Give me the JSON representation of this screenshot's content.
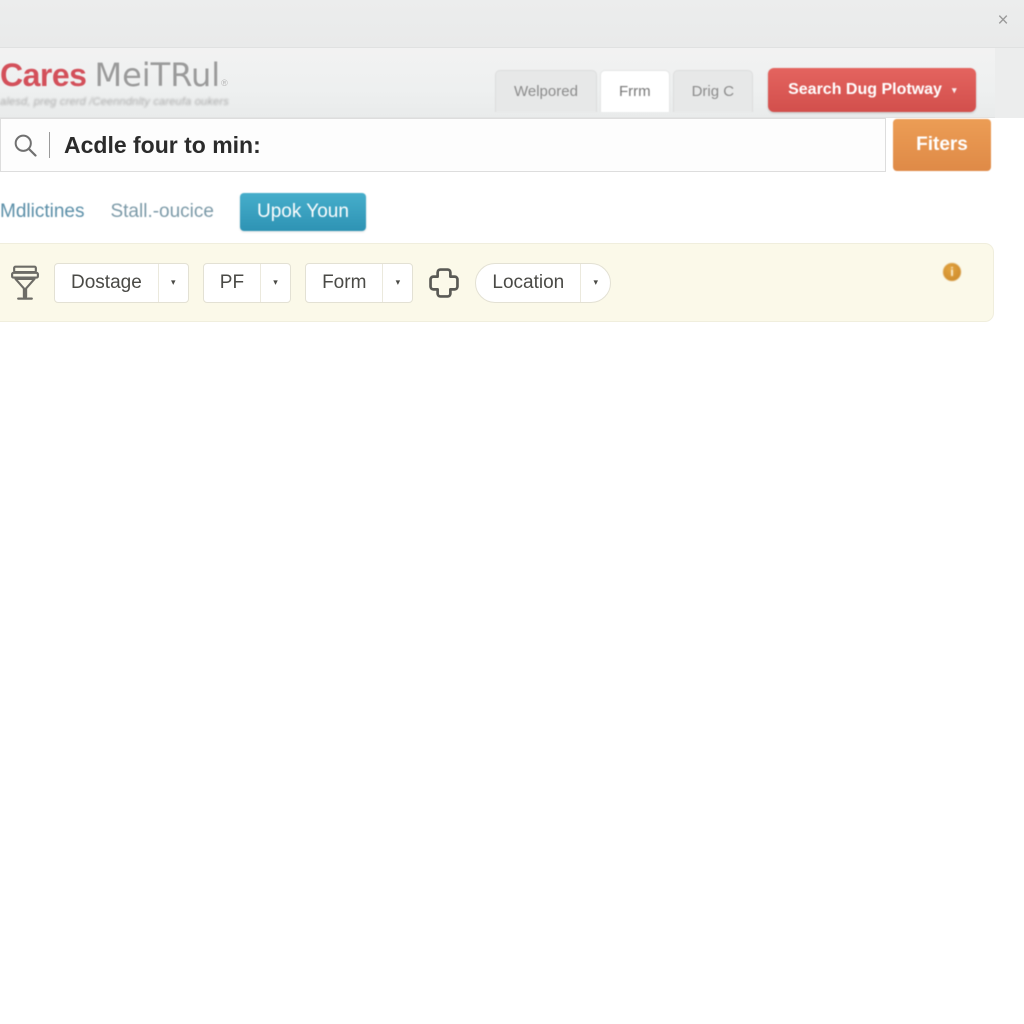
{
  "window": {
    "close_label": "×"
  },
  "header": {
    "logo": {
      "primary": "Cares",
      "secondary": "MeiTRul",
      "trademark": "®",
      "tagline": "alesd, preg crerd /Ceenndnlty careufa oukers"
    },
    "tabs": [
      {
        "label": "Welpored",
        "active": false
      },
      {
        "label": "Frrm",
        "active": true
      },
      {
        "label": "Drig C",
        "active": false
      }
    ],
    "action_button": {
      "label": "Search Dug Plotway",
      "caret": "▾",
      "color": "#d7554f"
    }
  },
  "search": {
    "icon": "search-icon",
    "value": "Acdle four to min:",
    "placeholder": "Acdle four to min:",
    "filters_label": "Fiters",
    "filters_color": "#e4924e"
  },
  "subnav": {
    "links": [
      {
        "label": "Mdlictines",
        "active": false
      },
      {
        "label": "Stall.-oucice",
        "active": false
      }
    ],
    "active_pill": {
      "label": "Upok Youn",
      "color": "#2e93b4"
    }
  },
  "filterbar": {
    "background": "#fbf9e9",
    "icon": "funnel-icon",
    "dropdowns": [
      {
        "label": "Dostage",
        "caret": "▾",
        "shape": "rect"
      },
      {
        "label": "PF",
        "caret": "▾",
        "shape": "rect"
      },
      {
        "label": "Form",
        "caret": "▾",
        "shape": "rect"
      }
    ],
    "add_icon": "plus-icon",
    "location_dropdown": {
      "label": "Location",
      "caret": "▾",
      "shape": "pill"
    },
    "info_badge": {
      "label": "i",
      "color": "#c9862a"
    }
  }
}
